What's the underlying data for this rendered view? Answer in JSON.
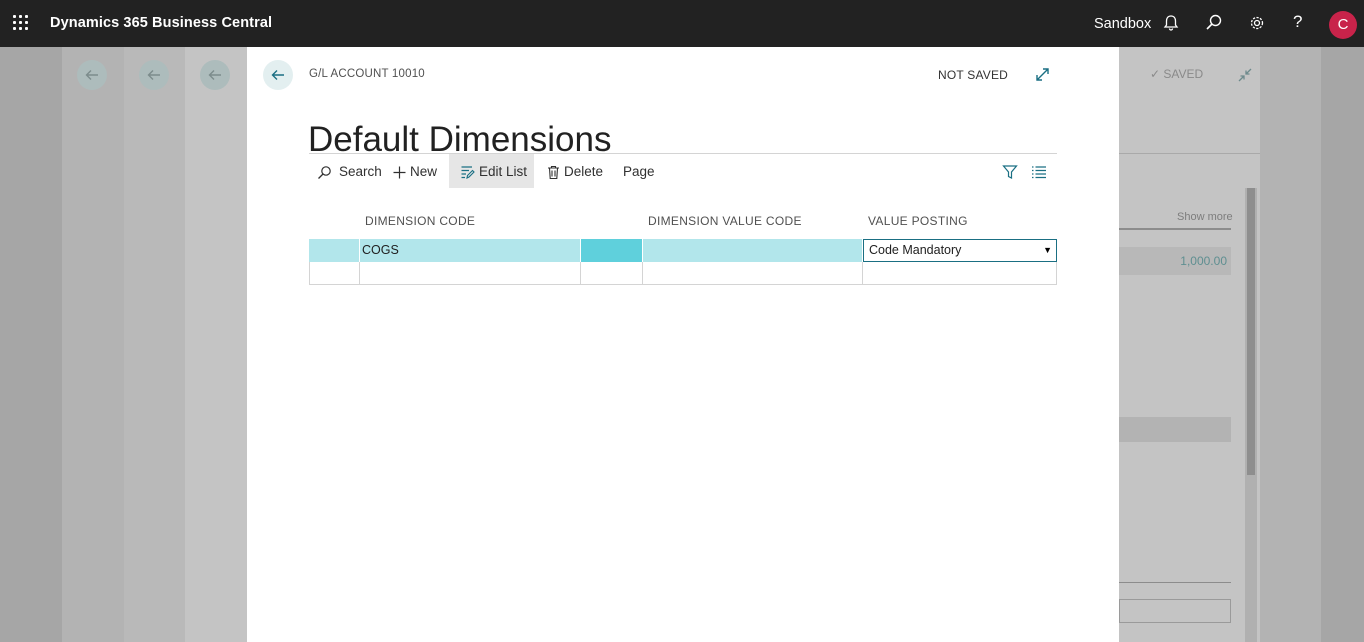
{
  "app": {
    "title": "Dynamics 365 Business Central",
    "environment": "Sandbox",
    "user_initial": "C",
    "icons": [
      "waffle-icon",
      "bell-icon",
      "search-icon",
      "gear-icon",
      "help-icon"
    ]
  },
  "background_page": {
    "status": "SAVED",
    "show_more": "Show more",
    "amount": "1,000.00"
  },
  "dialog": {
    "breadcrumb": "G/L ACCOUNT 10010",
    "status": "NOT SAVED",
    "title": "Default Dimensions",
    "actions": {
      "search": "Search",
      "new": "New",
      "edit_list": "Edit List",
      "delete": "Delete",
      "page": "Page"
    },
    "columns": {
      "dimension_code": "DIMENSION CODE",
      "dimension_value_code": "DIMENSION VALUE CODE",
      "value_posting": "VALUE POSTING"
    },
    "rows": [
      {
        "dimension_code": "COGS",
        "dimension_value_code": "",
        "value_posting": "Code Mandatory"
      },
      {
        "dimension_code": "",
        "dimension_value_code": "",
        "value_posting": ""
      }
    ]
  },
  "colors": {
    "top_bar": "#222222",
    "accent": "#1a6f83",
    "selected_row": "#b2e6eb",
    "selected_cell": "#5fd0dc",
    "avatar": "#c8234a"
  }
}
